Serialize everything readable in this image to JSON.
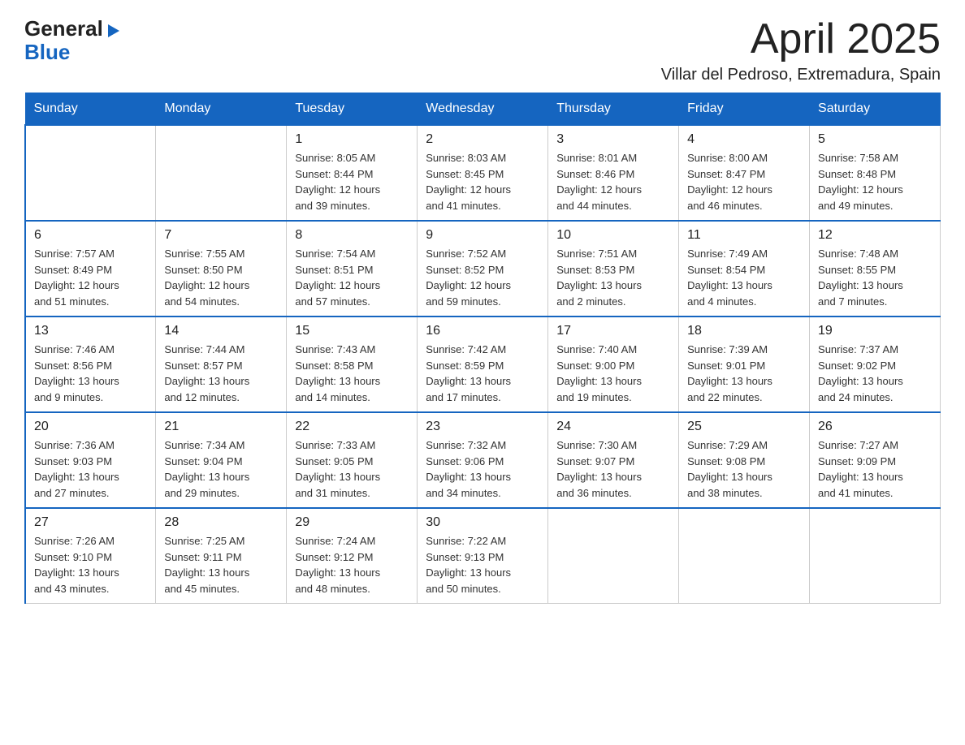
{
  "logo": {
    "general": "General",
    "blue": "Blue"
  },
  "title": "April 2025",
  "subtitle": "Villar del Pedroso, Extremadura, Spain",
  "weekdays": [
    "Sunday",
    "Monday",
    "Tuesday",
    "Wednesday",
    "Thursday",
    "Friday",
    "Saturday"
  ],
  "weeks": [
    [
      {
        "day": "",
        "info": ""
      },
      {
        "day": "",
        "info": ""
      },
      {
        "day": "1",
        "info": "Sunrise: 8:05 AM\nSunset: 8:44 PM\nDaylight: 12 hours\nand 39 minutes."
      },
      {
        "day": "2",
        "info": "Sunrise: 8:03 AM\nSunset: 8:45 PM\nDaylight: 12 hours\nand 41 minutes."
      },
      {
        "day": "3",
        "info": "Sunrise: 8:01 AM\nSunset: 8:46 PM\nDaylight: 12 hours\nand 44 minutes."
      },
      {
        "day": "4",
        "info": "Sunrise: 8:00 AM\nSunset: 8:47 PM\nDaylight: 12 hours\nand 46 minutes."
      },
      {
        "day": "5",
        "info": "Sunrise: 7:58 AM\nSunset: 8:48 PM\nDaylight: 12 hours\nand 49 minutes."
      }
    ],
    [
      {
        "day": "6",
        "info": "Sunrise: 7:57 AM\nSunset: 8:49 PM\nDaylight: 12 hours\nand 51 minutes."
      },
      {
        "day": "7",
        "info": "Sunrise: 7:55 AM\nSunset: 8:50 PM\nDaylight: 12 hours\nand 54 minutes."
      },
      {
        "day": "8",
        "info": "Sunrise: 7:54 AM\nSunset: 8:51 PM\nDaylight: 12 hours\nand 57 minutes."
      },
      {
        "day": "9",
        "info": "Sunrise: 7:52 AM\nSunset: 8:52 PM\nDaylight: 12 hours\nand 59 minutes."
      },
      {
        "day": "10",
        "info": "Sunrise: 7:51 AM\nSunset: 8:53 PM\nDaylight: 13 hours\nand 2 minutes."
      },
      {
        "day": "11",
        "info": "Sunrise: 7:49 AM\nSunset: 8:54 PM\nDaylight: 13 hours\nand 4 minutes."
      },
      {
        "day": "12",
        "info": "Sunrise: 7:48 AM\nSunset: 8:55 PM\nDaylight: 13 hours\nand 7 minutes."
      }
    ],
    [
      {
        "day": "13",
        "info": "Sunrise: 7:46 AM\nSunset: 8:56 PM\nDaylight: 13 hours\nand 9 minutes."
      },
      {
        "day": "14",
        "info": "Sunrise: 7:44 AM\nSunset: 8:57 PM\nDaylight: 13 hours\nand 12 minutes."
      },
      {
        "day": "15",
        "info": "Sunrise: 7:43 AM\nSunset: 8:58 PM\nDaylight: 13 hours\nand 14 minutes."
      },
      {
        "day": "16",
        "info": "Sunrise: 7:42 AM\nSunset: 8:59 PM\nDaylight: 13 hours\nand 17 minutes."
      },
      {
        "day": "17",
        "info": "Sunrise: 7:40 AM\nSunset: 9:00 PM\nDaylight: 13 hours\nand 19 minutes."
      },
      {
        "day": "18",
        "info": "Sunrise: 7:39 AM\nSunset: 9:01 PM\nDaylight: 13 hours\nand 22 minutes."
      },
      {
        "day": "19",
        "info": "Sunrise: 7:37 AM\nSunset: 9:02 PM\nDaylight: 13 hours\nand 24 minutes."
      }
    ],
    [
      {
        "day": "20",
        "info": "Sunrise: 7:36 AM\nSunset: 9:03 PM\nDaylight: 13 hours\nand 27 minutes."
      },
      {
        "day": "21",
        "info": "Sunrise: 7:34 AM\nSunset: 9:04 PM\nDaylight: 13 hours\nand 29 minutes."
      },
      {
        "day": "22",
        "info": "Sunrise: 7:33 AM\nSunset: 9:05 PM\nDaylight: 13 hours\nand 31 minutes."
      },
      {
        "day": "23",
        "info": "Sunrise: 7:32 AM\nSunset: 9:06 PM\nDaylight: 13 hours\nand 34 minutes."
      },
      {
        "day": "24",
        "info": "Sunrise: 7:30 AM\nSunset: 9:07 PM\nDaylight: 13 hours\nand 36 minutes."
      },
      {
        "day": "25",
        "info": "Sunrise: 7:29 AM\nSunset: 9:08 PM\nDaylight: 13 hours\nand 38 minutes."
      },
      {
        "day": "26",
        "info": "Sunrise: 7:27 AM\nSunset: 9:09 PM\nDaylight: 13 hours\nand 41 minutes."
      }
    ],
    [
      {
        "day": "27",
        "info": "Sunrise: 7:26 AM\nSunset: 9:10 PM\nDaylight: 13 hours\nand 43 minutes."
      },
      {
        "day": "28",
        "info": "Sunrise: 7:25 AM\nSunset: 9:11 PM\nDaylight: 13 hours\nand 45 minutes."
      },
      {
        "day": "29",
        "info": "Sunrise: 7:24 AM\nSunset: 9:12 PM\nDaylight: 13 hours\nand 48 minutes."
      },
      {
        "day": "30",
        "info": "Sunrise: 7:22 AM\nSunset: 9:13 PM\nDaylight: 13 hours\nand 50 minutes."
      },
      {
        "day": "",
        "info": ""
      },
      {
        "day": "",
        "info": ""
      },
      {
        "day": "",
        "info": ""
      }
    ]
  ]
}
